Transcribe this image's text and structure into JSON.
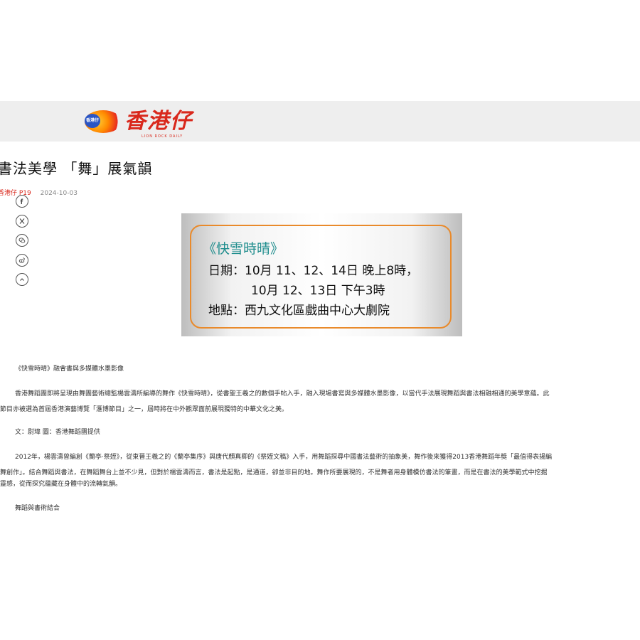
{
  "header": {
    "logo_badge": "香港仔",
    "logo_text": "香港仔",
    "logo_sub": "LION ROCK DAILY",
    "brand_color": "#d9281c"
  },
  "article": {
    "title": "書法美學 「舞」展氣韻",
    "source": "香港仔 P19",
    "date": "2024-10-03"
  },
  "share": {
    "icons": [
      "facebook-icon",
      "x-icon",
      "wechat-icon",
      "weibo-icon",
      "back-to-top-icon"
    ]
  },
  "poster": {
    "title": "《快雪時晴》",
    "line1": "日期：10月 11、12、14日 晚上8時，",
    "line2": "10月 12、13日 下午3時",
    "line3": "地點：西九文化區戲曲中心大劇院",
    "border_color": "#e98a2b",
    "title_color": "#1f8d8d"
  },
  "content": {
    "caption": "《快雪時晴》融會書與多媒體水墨影像",
    "p1_line1": "香港舞蹈團即將呈現由舞團藝術總監楊雲濤所編導的舞作《快雪時晴》，從書聖王羲之的數個手帖入手，融入現場書寫與多媒體水墨影像，以當代手法展現舞蹈與書法相融相通的美學意蘊。此",
    "p1_line2": "節目亦被選為首屆香港演藝博覽「滙博節目」之一，屆時將在中外觀眾面前展現獨特的中華文化之美。",
    "credit": "文：尉瑋 圖：香港舞蹈團提供",
    "p2_line1": "2012年，楊雲濤曾編創《蘭亭·祭姪》，從東晉王羲之的《蘭亭集序》與唐代顏真卿的《祭姪文稿》入手，用舞蹈探尋中國書法藝術的抽象美，舞作後來獲得2013香港舞蹈年獎「最值得表揚編",
    "p2_line2": "舞創作」。結合舞蹈與書法，在舞蹈舞台上並不少見，但對於楊雲濤而言，書法是起點，是通道，卻並非目的地。舞作所要展現的，不是舞者用身體模仿書法的筆畫，而是在書法的美學範式中挖掘",
    "p2_line3": "靈感，從而探究蘊藏在身體中的流轉氣韻。",
    "subhead": "舞蹈與書術結合"
  }
}
